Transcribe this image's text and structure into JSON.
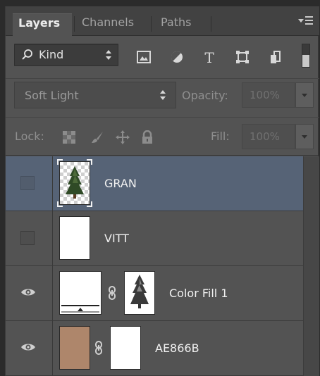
{
  "tabs": [
    {
      "label": "Layers",
      "active": true
    },
    {
      "label": "Channels",
      "active": false
    },
    {
      "label": "Paths",
      "active": false
    }
  ],
  "filter": {
    "kind_label": "Kind",
    "icons": [
      "image-filter-icon",
      "adjustment-filter-icon",
      "type-filter-icon",
      "shape-filter-icon",
      "smart-object-filter-icon"
    ]
  },
  "blend": {
    "mode": "Soft Light",
    "opacity_label": "Opacity:",
    "opacity_value": "100%"
  },
  "lock": {
    "label": "Lock:",
    "fill_label": "Fill:",
    "fill_value": "100%"
  },
  "layers": [
    {
      "name": "GRAN",
      "visible": false,
      "selected": true
    },
    {
      "name": "VITT",
      "visible": false,
      "selected": false
    },
    {
      "name": "Color Fill 1",
      "visible": true,
      "selected": false
    },
    {
      "name": "AE866B",
      "visible": true,
      "selected": false
    }
  ],
  "colors": {
    "panel_bg": "#535353",
    "selected_row": "#566376",
    "fill_swatch": "#ae866b"
  }
}
